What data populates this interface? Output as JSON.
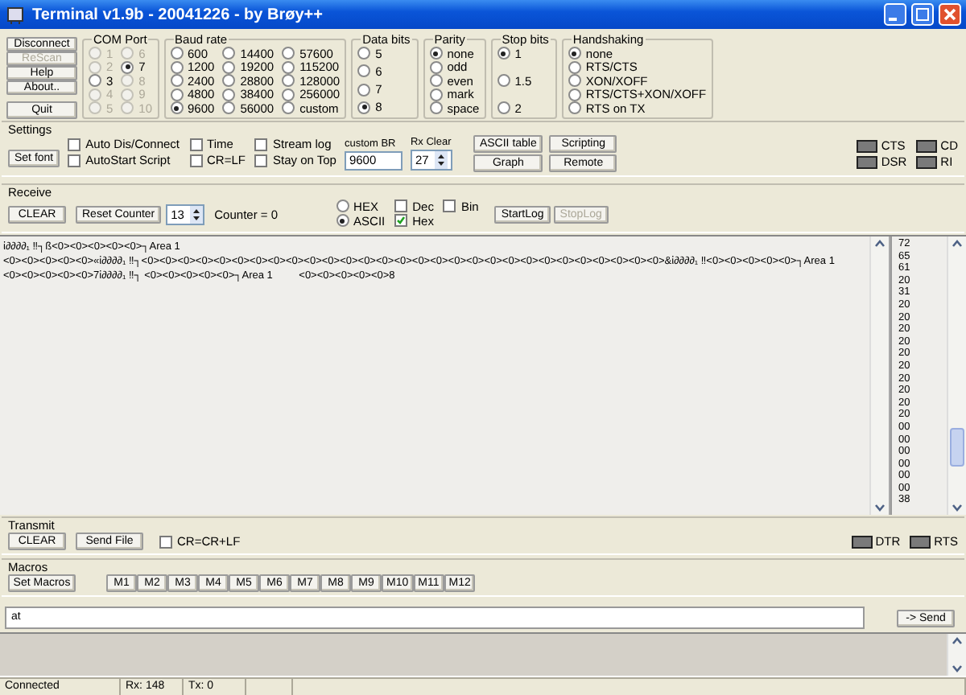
{
  "window": {
    "title": "Terminal v1.9b - 20041226 - by Brøy++"
  },
  "main_buttons": [
    {
      "label": "Disconnect",
      "disabled": false
    },
    {
      "label": "ReScan",
      "disabled": true
    },
    {
      "label": "Help",
      "disabled": false
    },
    {
      "label": "About..",
      "disabled": false
    },
    {
      "label": "Quit",
      "disabled": false
    }
  ],
  "option_groups": [
    {
      "title": "COM Port",
      "options": [
        {
          "label": "1",
          "selected": false,
          "disabled": true
        },
        {
          "label": "2",
          "selected": false,
          "disabled": true
        },
        {
          "label": "3",
          "selected": false,
          "disabled": false
        },
        {
          "label": "4",
          "selected": false,
          "disabled": true
        },
        {
          "label": "5",
          "selected": false,
          "disabled": true
        },
        {
          "label": "6",
          "selected": false,
          "disabled": true
        },
        {
          "label": "7",
          "selected": true,
          "disabled": false
        },
        {
          "label": "8",
          "selected": false,
          "disabled": true
        },
        {
          "label": "9",
          "selected": false,
          "disabled": true
        },
        {
          "label": "10",
          "selected": false,
          "disabled": true
        }
      ]
    },
    {
      "title": "Baud rate",
      "options": [
        {
          "label": "600",
          "selected": false
        },
        {
          "label": "1200",
          "selected": false
        },
        {
          "label": "2400",
          "selected": false
        },
        {
          "label": "4800",
          "selected": false
        },
        {
          "label": "9600",
          "selected": true
        },
        {
          "label": "14400",
          "selected": false
        },
        {
          "label": "19200",
          "selected": false
        },
        {
          "label": "28800",
          "selected": false
        },
        {
          "label": "38400",
          "selected": false
        },
        {
          "label": "56000",
          "selected": false
        },
        {
          "label": "57600",
          "selected": false
        },
        {
          "label": "115200",
          "selected": false
        },
        {
          "label": "128000",
          "selected": false
        },
        {
          "label": "256000",
          "selected": false
        },
        {
          "label": "custom",
          "selected": false
        }
      ]
    },
    {
      "title": "Data bits",
      "options": [
        {
          "label": "5",
          "selected": false
        },
        {
          "label": "6",
          "selected": false
        },
        {
          "label": "7",
          "selected": false
        },
        {
          "label": "8",
          "selected": true
        }
      ]
    },
    {
      "title": "Parity",
      "options": [
        {
          "label": "none",
          "selected": true
        },
        {
          "label": "odd",
          "selected": false
        },
        {
          "label": "even",
          "selected": false
        },
        {
          "label": "mark",
          "selected": false
        },
        {
          "label": "space",
          "selected": false
        }
      ]
    },
    {
      "title": "Stop bits",
      "options": [
        {
          "label": "1",
          "selected": true
        },
        {
          "label": "1.5",
          "selected": false
        },
        {
          "label": "2",
          "selected": false
        }
      ]
    },
    {
      "title": "Handshaking",
      "options": [
        {
          "label": "none",
          "selected": true
        },
        {
          "label": "RTS/CTS",
          "selected": false
        },
        {
          "label": "XON/XOFF",
          "selected": false
        },
        {
          "label": "RTS/CTS+XON/XOFF",
          "selected": false
        },
        {
          "label": "RTS on TX",
          "selected": false
        }
      ]
    }
  ],
  "settings": {
    "title": "Settings",
    "font_button": "Set font",
    "checkboxes": [
      {
        "label": "Auto Dis/Connect",
        "checked": false
      },
      {
        "label": "AutoStart Script",
        "checked": false
      },
      {
        "label": "Time",
        "checked": false
      },
      {
        "label": "CR=LF",
        "checked": false
      },
      {
        "label": "Stream log",
        "checked": false
      },
      {
        "label": "Stay on Top",
        "checked": false
      }
    ],
    "custom_br": {
      "label": "custom BR",
      "value": "9600"
    },
    "rx_clear": {
      "label": "Rx Clear",
      "value": "27"
    },
    "buttons": [
      "ASCII table",
      "Graph",
      "Scripting",
      "Remote"
    ],
    "indicators": [
      {
        "label": "CTS",
        "on": false
      },
      {
        "label": "CD",
        "on": false
      },
      {
        "label": "DSR",
        "on": false
      },
      {
        "label": "RI",
        "on": false
      }
    ]
  },
  "receive": {
    "title": "Receive",
    "clear_button": "CLEAR",
    "reset_button": "Reset Counter",
    "counter_spinner": "13",
    "counter": "Counter =  0",
    "modes": [
      {
        "label": "HEX",
        "selected": false
      },
      {
        "label": "ASCII",
        "selected": true
      }
    ],
    "display": [
      {
        "label": "Dec",
        "checked": false
      },
      {
        "label": "Hex",
        "checked": true
      },
      {
        "label": "Bin",
        "checked": false
      }
    ],
    "log_buttons": [
      {
        "label": "StartLog",
        "disabled": false
      },
      {
        "label": "StopLog",
        "disabled": true
      }
    ],
    "lines": [
      "ἰ∂∂∂∂₁ ‼┐ß<0><0><0><0><0>┐Area 1",
      "<0><0><0><0><0>«ἰ∂∂∂∂₁ ‼┐<0><0><0><0><0><0><0><0><0><0><0><0><0><0><0><0><0><0><0><0><0><0><0><0><0><0><0><0><0>&ἰ∂∂∂∂₁ ‼<0><0><0><0><0>┐Area 1",
      "<0><0><0><0><0>7ἰ∂∂∂∂₁ ‼┐ <0><0><0><0><0>┐Area 1         <0><0><0><0><0>8"
    ],
    "hex_values": [
      "72",
      "65",
      "61",
      "20",
      "31",
      "20",
      "20",
      "20",
      "20",
      "20",
      "20",
      "20",
      "20",
      "20",
      "20",
      "00",
      "00",
      "00",
      "00",
      "00",
      "00",
      "38"
    ]
  },
  "transmit": {
    "title": "Transmit",
    "clear_button": "CLEAR",
    "send_file_button": "Send File",
    "checkbox": {
      "label": "CR=CR+LF",
      "checked": false
    },
    "indicators": [
      {
        "label": "DTR",
        "on": false
      },
      {
        "label": "RTS",
        "on": false
      }
    ]
  },
  "macros": {
    "title": "Macros",
    "set_button": "Set Macros",
    "buttons": [
      "M1",
      "M2",
      "M3",
      "M4",
      "M5",
      "M6",
      "M7",
      "M8",
      "M9",
      "M10",
      "M11",
      "M12"
    ]
  },
  "input": {
    "value": "at",
    "send_button": "-> Send"
  },
  "status_bar": [
    "Connected",
    "Rx: 148",
    "Tx: 0"
  ]
}
